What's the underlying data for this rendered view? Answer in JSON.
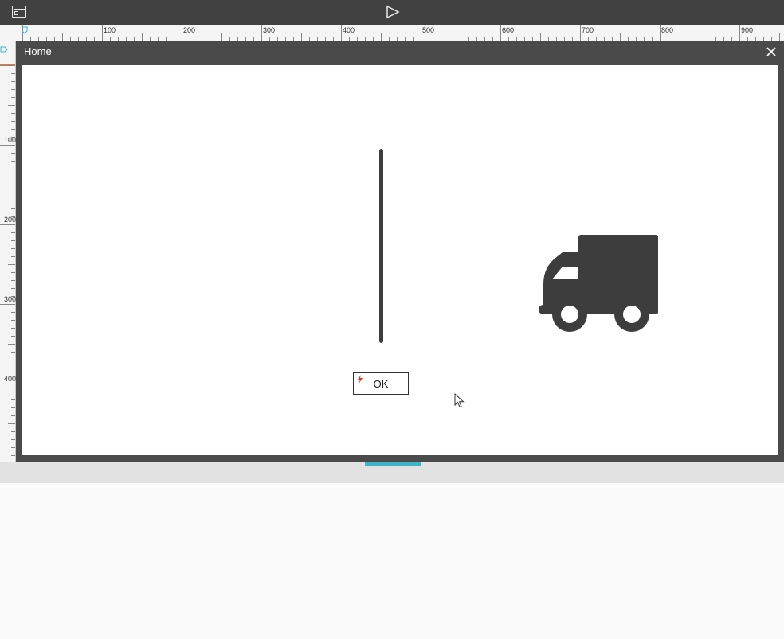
{
  "toolbar": {
    "layout_icon": "layout-icon",
    "play_icon": "play-icon"
  },
  "rulers": {
    "horizontal_labels": [
      "100",
      "200",
      "300",
      "400",
      "500",
      "600",
      "700",
      "800",
      "900"
    ],
    "vertical_labels": [
      "100",
      "200",
      "300",
      "400"
    ]
  },
  "dialog": {
    "title": "Home",
    "close_icon": "close-icon"
  },
  "canvas": {
    "ok_button_label": "OK",
    "truck_icon": "truck-icon",
    "bolt_icon": "bolt-icon"
  },
  "colors": {
    "toolbar_bg": "#414141",
    "dialog_bg": "#4a4a4a",
    "accent": "#3fb4c7",
    "bolt": "#e03a1e",
    "shape": "#3d3d3d"
  }
}
